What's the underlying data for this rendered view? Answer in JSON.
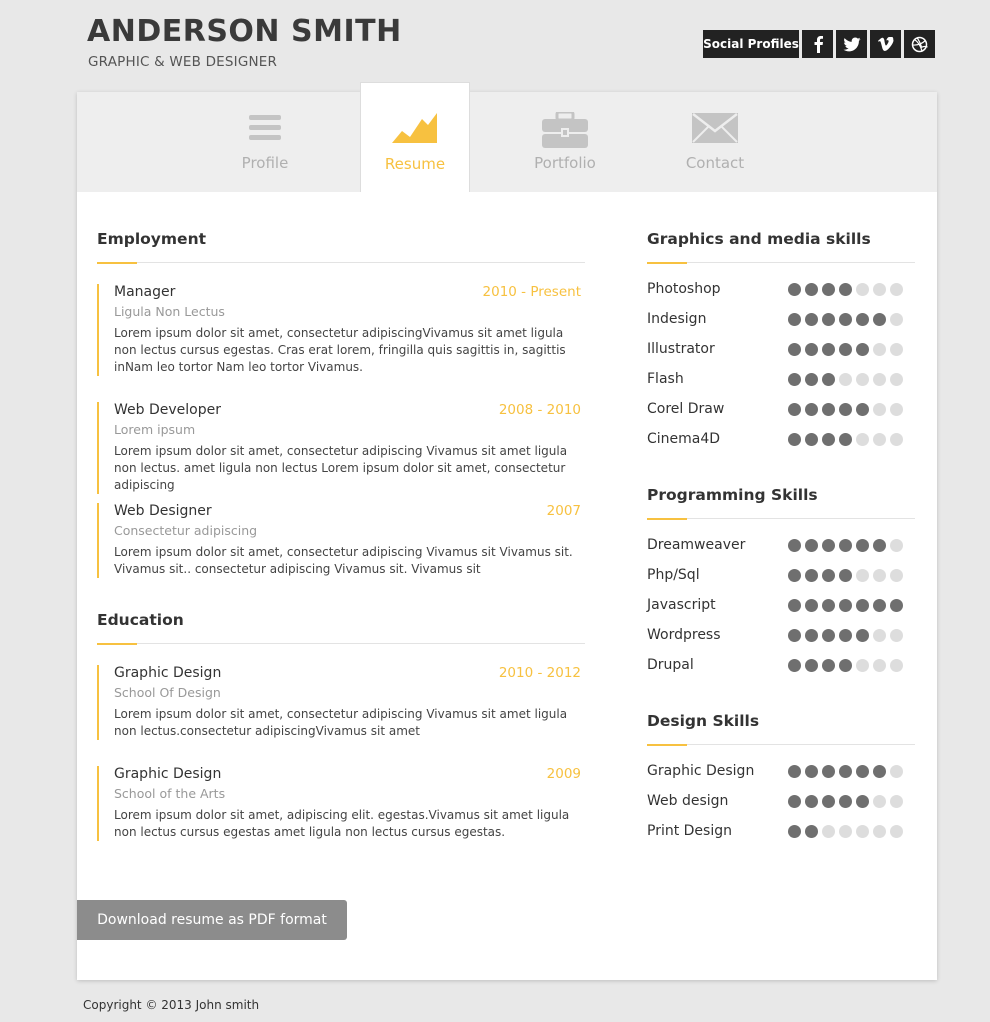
{
  "header": {
    "name": "ANDERSON SMITH",
    "title": "GRAPHIC & WEB DESIGNER",
    "social_label": "Social Profiles",
    "social_icons": [
      "facebook-icon",
      "twitter-icon",
      "vimeo-icon",
      "dribbble-icon"
    ]
  },
  "nav": {
    "tabs": [
      {
        "label": "Profile",
        "icon": "menu-icon"
      },
      {
        "label": "Resume",
        "icon": "chart-icon"
      },
      {
        "label": "Portfolio",
        "icon": "briefcase-icon"
      },
      {
        "label": "Contact",
        "icon": "envelope-icon"
      }
    ],
    "active": "Resume"
  },
  "employment": {
    "title": "Employment",
    "entries": [
      {
        "role": "Manager",
        "period": "2010 - Present",
        "org": "Ligula Non Lectus",
        "desc": "Lorem ipsum dolor sit amet, consectetur adipiscingVivamus sit amet ligula non lectus cursus egestas. Cras erat lorem, fringilla quis sagittis in, sagittis inNam leo tortor Nam leo tortor Vivamus."
      },
      {
        "role": "Web Developer",
        "period": "2008 - 2010",
        "org": "Lorem ipsum",
        "desc": "Lorem ipsum dolor sit amet, consectetur adipiscing Vivamus sit amet ligula non lectus. amet ligula non lectus Lorem ipsum dolor sit amet, consectetur adipiscing"
      },
      {
        "role": "Web Designer",
        "period": "2007",
        "org": "Consectetur adipiscing",
        "desc": "Lorem ipsum dolor sit amet, consectetur adipiscing Vivamus sit Vivamus sit. Vivamus sit.. consectetur adipiscing Vivamus sit. Vivamus sit"
      }
    ]
  },
  "education": {
    "title": "Education",
    "entries": [
      {
        "role": "Graphic Design",
        "period": "2010 - 2012",
        "org": "School Of Design",
        "desc": "Lorem ipsum dolor sit amet, consectetur adipiscing Vivamus sit amet ligula non lectus.consectetur adipiscingVivamus sit amet"
      },
      {
        "role": "Graphic Design",
        "period": "2009",
        "org": "School of the Arts",
        "desc": "Lorem ipsum dolor sit amet, adipiscing elit. egestas.Vivamus sit amet ligula non lectus cursus egestas amet ligula non lectus cursus egestas."
      }
    ]
  },
  "skills": [
    {
      "title": "Graphics and media skills",
      "items": [
        {
          "name": "Photoshop",
          "level": 4
        },
        {
          "name": "Indesign",
          "level": 6
        },
        {
          "name": "Illustrator",
          "level": 5
        },
        {
          "name": "Flash",
          "level": 3
        },
        {
          "name": "Corel Draw",
          "level": 5
        },
        {
          "name": "Cinema4D",
          "level": 4
        }
      ]
    },
    {
      "title": "Programming Skills",
      "items": [
        {
          "name": "Dreamweaver",
          "level": 6
        },
        {
          "name": "Php/Sql",
          "level": 4
        },
        {
          "name": "Javascript",
          "level": 7
        },
        {
          "name": "Wordpress",
          "level": 5
        },
        {
          "name": "Drupal",
          "level": 4
        }
      ]
    },
    {
      "title": "Design Skills",
      "items": [
        {
          "name": "Graphic Design",
          "level": 6
        },
        {
          "name": "Web design",
          "level": 5
        },
        {
          "name": "Print Design",
          "level": 2
        }
      ]
    }
  ],
  "skill_max": 7,
  "download_label": "Download resume as PDF format",
  "footer": "Copyright © 2013 John smith",
  "colors": {
    "accent": "#f7c140",
    "dot_on": "#6f6f6f",
    "dot_off": "#dddddd"
  }
}
